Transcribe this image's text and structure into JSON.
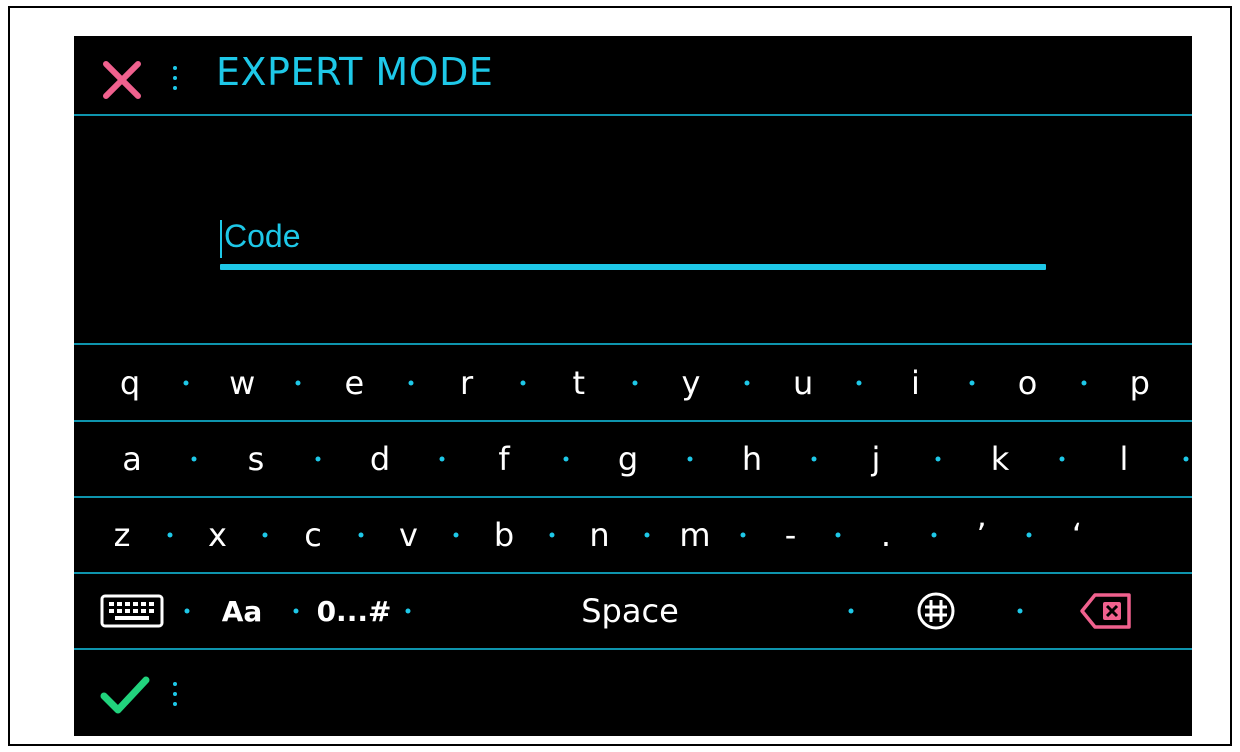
{
  "header": {
    "title": "EXPERT MODE"
  },
  "input": {
    "placeholder": "Code",
    "value": ""
  },
  "keyboard": {
    "rows": [
      [
        "q",
        "w",
        "e",
        "r",
        "t",
        "y",
        "u",
        "i",
        "o",
        "p"
      ],
      [
        "a",
        "s",
        "d",
        "f",
        "g",
        "h",
        "j",
        "k",
        "l"
      ],
      [
        "z",
        "x",
        "c",
        "v",
        "b",
        "n",
        "m",
        "-",
        ".",
        "’",
        "‘"
      ]
    ],
    "bottom": {
      "case_label": "Aa",
      "symbols_label": "0...#",
      "space_label": "Space"
    }
  },
  "colors": {
    "accent": "#1ec8e8",
    "divider": "#0e94ad",
    "close": "#f0618e",
    "confirm": "#21d37d",
    "background": "#000000"
  },
  "icons": {
    "close": "close-icon",
    "keyboard": "keyboard-icon",
    "globe": "globe-icon",
    "backspace": "backspace-icon",
    "confirm": "check-icon"
  }
}
